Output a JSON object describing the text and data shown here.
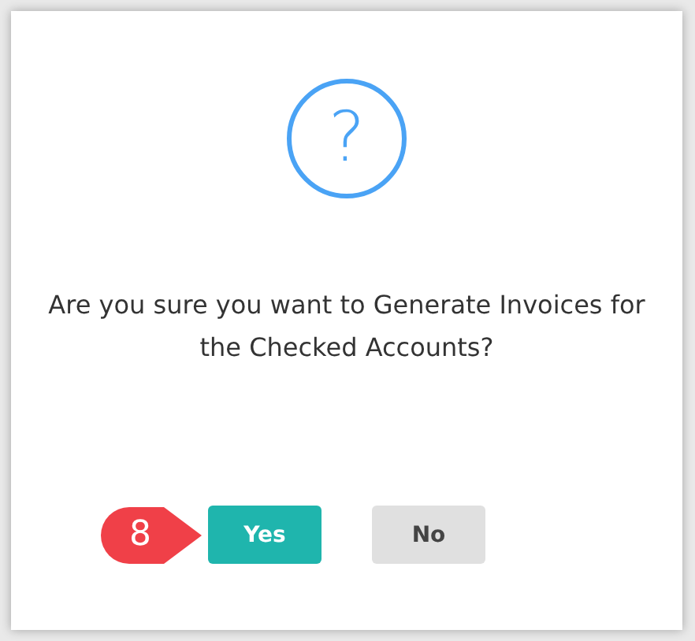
{
  "dialog": {
    "icon_glyph": "?",
    "message": "Are you sure you want to Generate Invoices for the Checked Accounts?",
    "buttons": [
      {
        "label": "Yes",
        "kind": "primary"
      },
      {
        "label": "No",
        "kind": "secondary"
      }
    ],
    "callout": {
      "number": "8"
    }
  }
}
